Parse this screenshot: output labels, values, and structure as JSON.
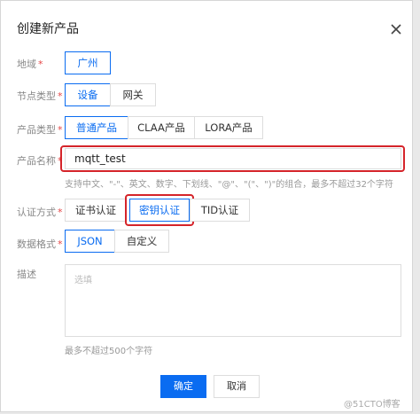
{
  "dialog": {
    "title": "创建新产品",
    "confirm_label": "确定",
    "cancel_label": "取消"
  },
  "region": {
    "label": "地域",
    "options": [
      "广州"
    ]
  },
  "node_type": {
    "label": "节点类型",
    "options": [
      "设备",
      "网关"
    ]
  },
  "product_type": {
    "label": "产品类型",
    "options": [
      "普通产品",
      "CLAA产品",
      "LORA产品"
    ]
  },
  "product_name": {
    "label": "产品名称",
    "value": "mqtt_test",
    "hint": "支持中文、\"-\"、英文、数字、下划线、\"@\"、\"(\"、\")\"的组合，最多不超过32个字符"
  },
  "auth_method": {
    "label": "认证方式",
    "options": [
      "证书认证",
      "密钥认证",
      "TID认证"
    ]
  },
  "data_format": {
    "label": "数据格式",
    "options": [
      "JSON",
      "自定义"
    ]
  },
  "description": {
    "label": "描述",
    "placeholder": "选填",
    "hint": "最多不超过500个字符"
  },
  "watermark": "@51CTO博客",
  "colors": {
    "accent": "#0a6cf1",
    "highlight": "#d5242a",
    "required": "#e54545"
  }
}
